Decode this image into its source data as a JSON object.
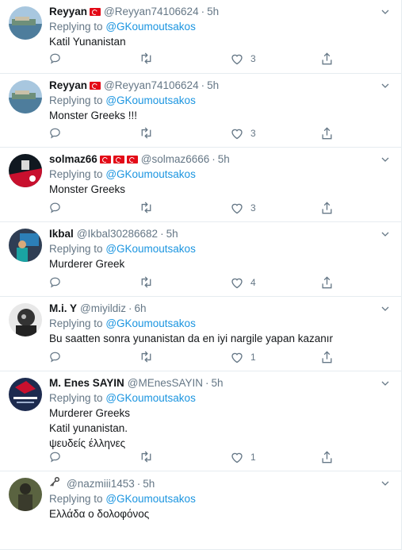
{
  "reply_prefix": "Replying to",
  "tweets": [
    {
      "name": "Reyyan",
      "flags": 1,
      "handle": "@Reyyan74106624",
      "dot": "·",
      "time": "5h",
      "replying_to": "@GKoumoutsakos",
      "text": [
        "Katil Yunanistan"
      ],
      "likes": "3"
    },
    {
      "name": "Reyyan",
      "flags": 1,
      "handle": "@Reyyan74106624",
      "dot": "·",
      "time": "5h",
      "replying_to": "@GKoumoutsakos",
      "text": [
        "Monster Greeks !!!"
      ],
      "likes": "3"
    },
    {
      "name": "solmaz66",
      "flags": 3,
      "handle": "@solmaz6666",
      "dot": "·",
      "time": "5h",
      "replying_to": "@GKoumoutsakos",
      "text": [
        "Monster Greeks"
      ],
      "likes": "3"
    },
    {
      "name": "Ikbal",
      "flags": 0,
      "handle": "@Ikbal30286682",
      "dot": "·",
      "time": "5h",
      "replying_to": "@GKoumoutsakos",
      "text": [
        "Murderer Greek"
      ],
      "likes": "4"
    },
    {
      "name": "M.i. Y",
      "flags": 0,
      "handle": "@miyildiz",
      "dot": "·",
      "time": "6h",
      "replying_to": "@GKoumoutsakos",
      "text": [
        "Bu saatten sonra yunanistan da en iyi nargile yapan kazanır"
      ],
      "likes": "1"
    },
    {
      "name": "M. Enes SAYIN",
      "flags": 0,
      "handle": "@MEnesSAYIN",
      "dot": "·",
      "time": "5h",
      "replying_to": "@GKoumoutsakos",
      "text": [
        "Murderer Greeks",
        "Katil yunanistan.",
        "ψευδείς έλληνες"
      ],
      "likes": "1"
    },
    {
      "name": "",
      "flags": 0,
      "key_icon": true,
      "handle": "@nazmiii1453",
      "dot": "·",
      "time": "5h",
      "replying_to": "@GKoumoutsakos",
      "text": [
        "Ελλάδα ο δολοφόνος"
      ],
      "likes": ""
    }
  ],
  "icons": {
    "reply": "reply-icon",
    "retweet": "retweet-icon",
    "like": "heart-icon",
    "share": "share-icon",
    "menu": "chevron-down-icon"
  },
  "colors": {
    "link": "#1b95e0",
    "muted": "#657786",
    "text": "#14171a",
    "border": "#e6ecf0",
    "flag": "#e30a17"
  }
}
